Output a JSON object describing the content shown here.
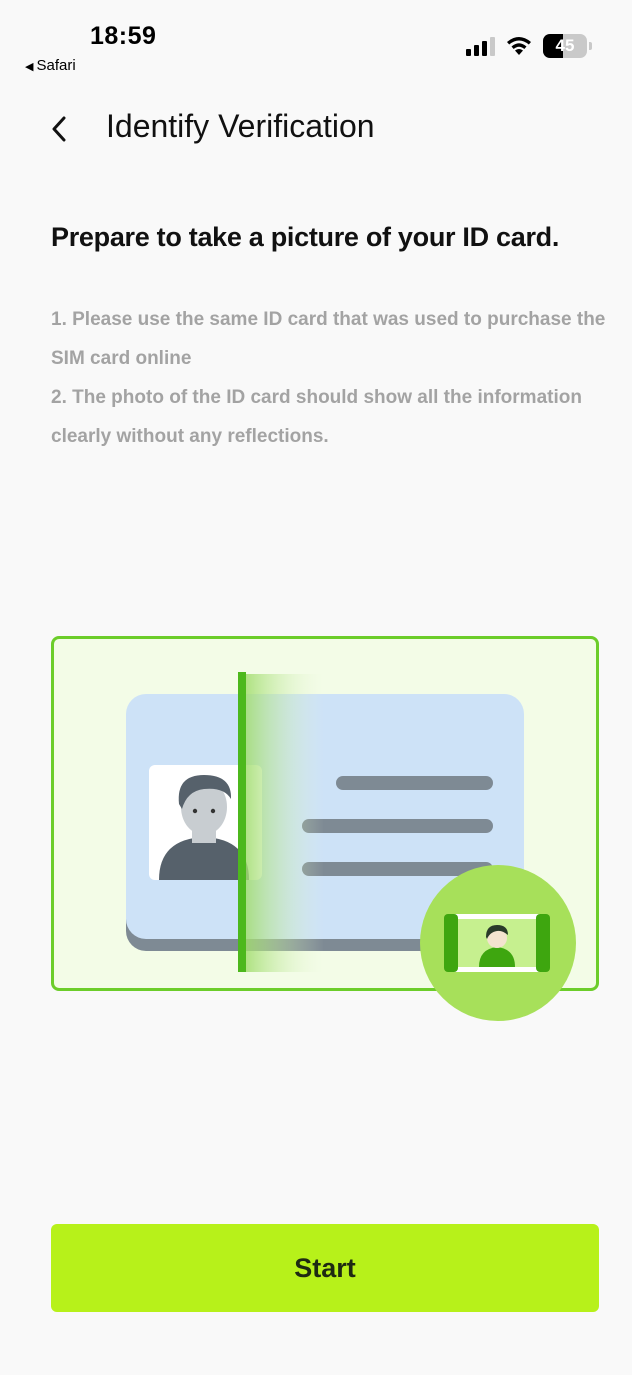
{
  "status_bar": {
    "time": "18:59",
    "back_app_label": "Safari",
    "back_arrow": "◀",
    "battery_percent": "45"
  },
  "header": {
    "title": "Identify Verification"
  },
  "content": {
    "heading": "Prepare to take a picture of your ID card.",
    "instruction_1": "1. Please use the same ID card that was used to purchase the SIM card online",
    "instruction_2": "2. The photo of the ID card should show all the information clearly without any reflections."
  },
  "illustration": {
    "icon": "id-card-scan-illustration",
    "accent_color": "#6ccd2a",
    "card_color": "#cde2f7"
  },
  "actions": {
    "start_label": "Start",
    "start_color": "#b7f11a"
  }
}
